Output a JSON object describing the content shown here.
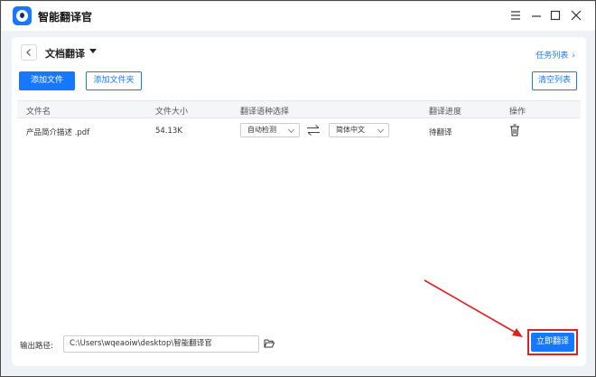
{
  "window": {
    "app_title": "智能翻译官",
    "controls": [
      "minimize",
      "maximize",
      "close"
    ]
  },
  "toolbar": {
    "back_icon": "chevron-left-icon",
    "page_title": "文档翻译",
    "task_list_label": "任务列表",
    "task_list_chevron": "›",
    "add_file_label": "添加文件",
    "add_folder_label": "添加文件夹",
    "clear_list_label": "清空列表"
  },
  "table": {
    "headers": {
      "file_name": "文件名",
      "file_size": "文件大小",
      "languages": "翻译语种选择",
      "progress": "翻译进度",
      "actions": "操作"
    },
    "rows": [
      {
        "file_name": "产品简介描述 .pdf",
        "file_size": "54.13K",
        "source_language": "自动检测",
        "target_language": "简体中文",
        "status": "待翻译"
      }
    ]
  },
  "footer": {
    "output_label": "输出路径:",
    "output_path": "C:\\Users\\wqeaoiw\\desktop\\智能翻译官",
    "translate_label": "立即翻译"
  },
  "colors": {
    "accent": "#1677ff",
    "highlight": "#e02020",
    "background": "#eef1f6"
  }
}
